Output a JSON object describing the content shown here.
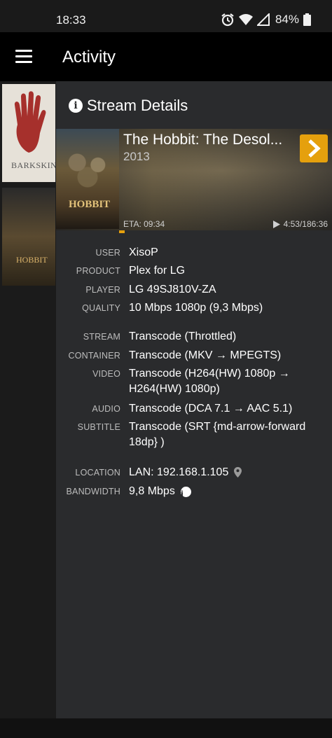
{
  "status_bar": {
    "time": "18:33",
    "battery": "84%",
    "icons": [
      "alarm-icon",
      "wifi-icon",
      "signal-icon",
      "battery-icon"
    ]
  },
  "app_bar": {
    "title": "Activity",
    "menu_icon": "menu-icon"
  },
  "background_list": {
    "items": [
      {
        "poster_text": "BARKSKINS"
      },
      {
        "poster_text": "HOBBIT"
      }
    ]
  },
  "sheet": {
    "title": "Stream Details",
    "title_icon": "info-icon",
    "media": {
      "title": "The Hobbit: The Desol...",
      "year": "2013",
      "poster_text": "HOBBIT",
      "eta": "ETA: 09:34",
      "progress_text": "4:53/186:36",
      "progress_fraction": 0.026,
      "next_icon": "chevron-right-icon"
    },
    "details": [
      {
        "label": "USER",
        "value": "XisoP"
      },
      {
        "label": "PRODUCT",
        "value": "Plex for LG"
      },
      {
        "label": "PLAYER",
        "value": "LG 49SJ810V-ZA"
      },
      {
        "label": "QUALITY",
        "value": "10 Mbps 1080p (9,3 Mbps)"
      },
      {
        "label": "STREAM",
        "value": "Transcode (Throttled)"
      },
      {
        "label": "CONTAINER",
        "value": "Transcode (MKV → MPEGTS)"
      },
      {
        "label": "VIDEO",
        "value": "Transcode (H264(HW) 1080p → H264(HW) 1080p)"
      },
      {
        "label": "AUDIO",
        "value": "Transcode (DCA 7.1 → AAC 5.1)"
      },
      {
        "label": "SUBTITLE",
        "value": "Transcode (SRT {md-arrow-forward 18dp} )"
      },
      {
        "label": "LOCATION",
        "value": "LAN: 192.168.1.105",
        "icon": "location-pin-icon"
      },
      {
        "label": "BANDWIDTH",
        "value": "9,8 Mbps",
        "icon": "info-icon"
      }
    ]
  },
  "colors": {
    "accent": "#e5a00d",
    "sheet_bg": "#2a2b2d",
    "app_bar_bg": "#000000"
  }
}
